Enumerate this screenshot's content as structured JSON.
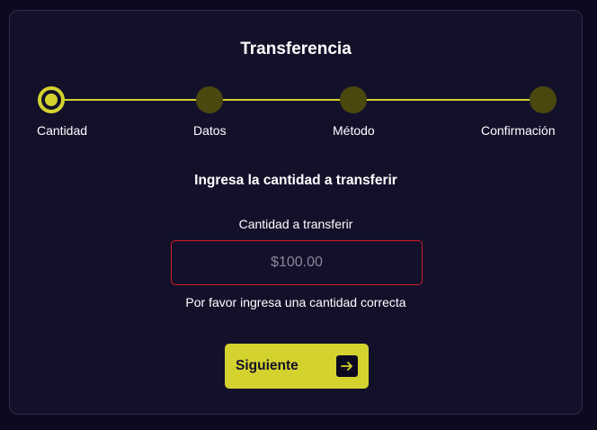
{
  "title": "Transferencia",
  "stepper": {
    "steps": [
      {
        "label": "Cantidad",
        "state": "active"
      },
      {
        "label": "Datos",
        "state": "pending"
      },
      {
        "label": "Método",
        "state": "pending"
      },
      {
        "label": "Confirmación",
        "state": "pending"
      }
    ]
  },
  "form": {
    "heading": "Ingresa la cantidad a transferir",
    "amount_label": "Cantidad a transferir",
    "amount_placeholder": "$100.00",
    "amount_value": "",
    "error_message": "Por favor ingresa una cantidad correcta"
  },
  "actions": {
    "next_label": "Siguiente",
    "next_icon": "arrow-right-icon"
  },
  "colors": {
    "background": "#0c0a1f",
    "card": "#13112a",
    "accent": "#d4d22e",
    "inactive_step": "#4a480e",
    "error_border": "#d11a2a"
  }
}
